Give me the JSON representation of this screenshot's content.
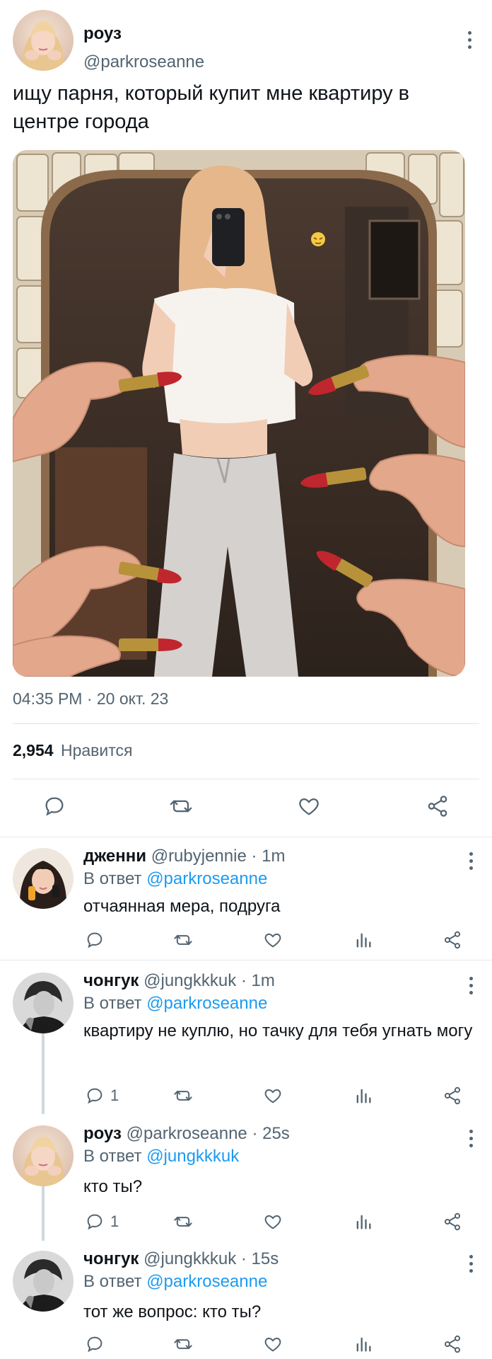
{
  "main_tweet": {
    "author_name": "роуз",
    "handle": "@parkroseanne",
    "text": "ищу парня, который купит мне квартиру в центре города",
    "timestamp": "04:35 PM · 20 окт. 23",
    "likes_count": "2,954",
    "likes_label": "Нравится",
    "actions": [
      "reply-icon",
      "retweet-icon",
      "like-icon",
      "share-icon"
    ]
  },
  "replies": [
    {
      "name": "дженни",
      "handle": "@rubyjennie",
      "time": "· 1m",
      "reply_prefix": "В ответ",
      "reply_to": "@parkroseanne",
      "text": "отчаянная мера, подруга",
      "reply_count": ""
    },
    {
      "name": "чонгук",
      "handle": "@jungkkkuk",
      "time": "· 1m",
      "reply_prefix": "В ответ",
      "reply_to": "@parkroseanne",
      "text": "квартиру не куплю, но тачку для тебя угнать могу",
      "reply_count": "1"
    },
    {
      "name": "роуз",
      "handle": "@parkroseanne",
      "time": "· 25s",
      "reply_prefix": "В ответ",
      "reply_to": "@jungkkkuk",
      "text": "кто ты?",
      "reply_count": "1"
    },
    {
      "name": "чонгук",
      "handle": "@jungkkkuk",
      "time": "· 15s",
      "reply_prefix": "В ответ",
      "reply_to": "@parkroseanne",
      "text": "тот же вопрос: кто ты?",
      "reply_count": ""
    }
  ],
  "colors": {
    "accent": "#1d9bf0",
    "secondary_text": "#536471",
    "lipstick": "#c0262d"
  }
}
